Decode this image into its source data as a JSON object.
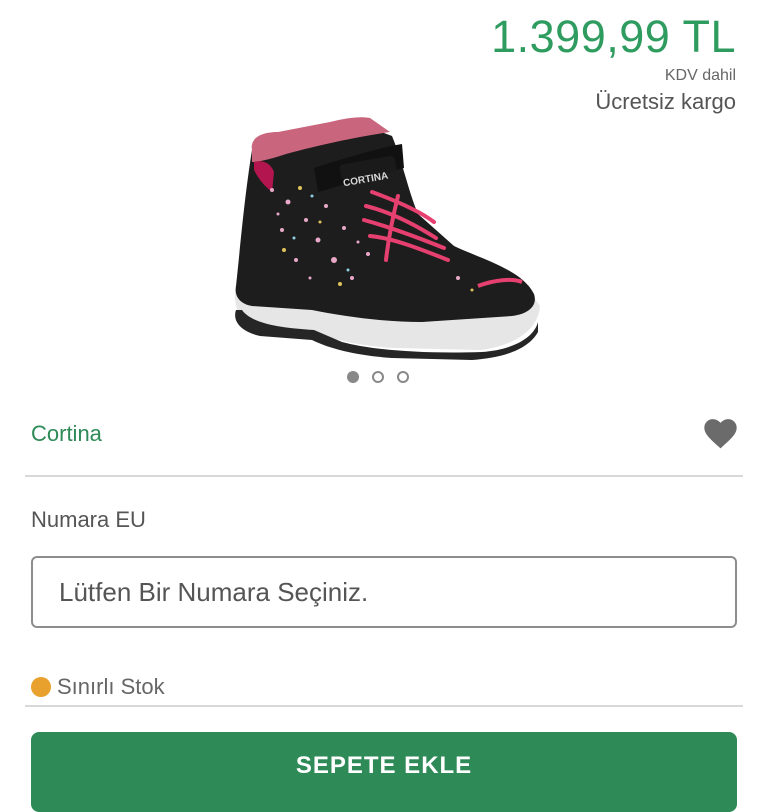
{
  "price": {
    "amount": "1.399,99 TL",
    "vat_note": "KDV dahil",
    "shipping": "Ücretsiz kargo"
  },
  "product": {
    "brand": "Cortina",
    "image_logo_text": "CORTINA",
    "carousel_total": 3,
    "carousel_active": 1
  },
  "size": {
    "label": "Numara EU",
    "placeholder": "Lütfen Bir Numara Seçiniz."
  },
  "stock": {
    "text": "Sınırlı Stok",
    "color": "#e9a12d"
  },
  "cart": {
    "button_label": "SEPETE EKLE"
  },
  "colors": {
    "brand_green": "#2e8a57",
    "price_green": "#2e9b5f"
  }
}
